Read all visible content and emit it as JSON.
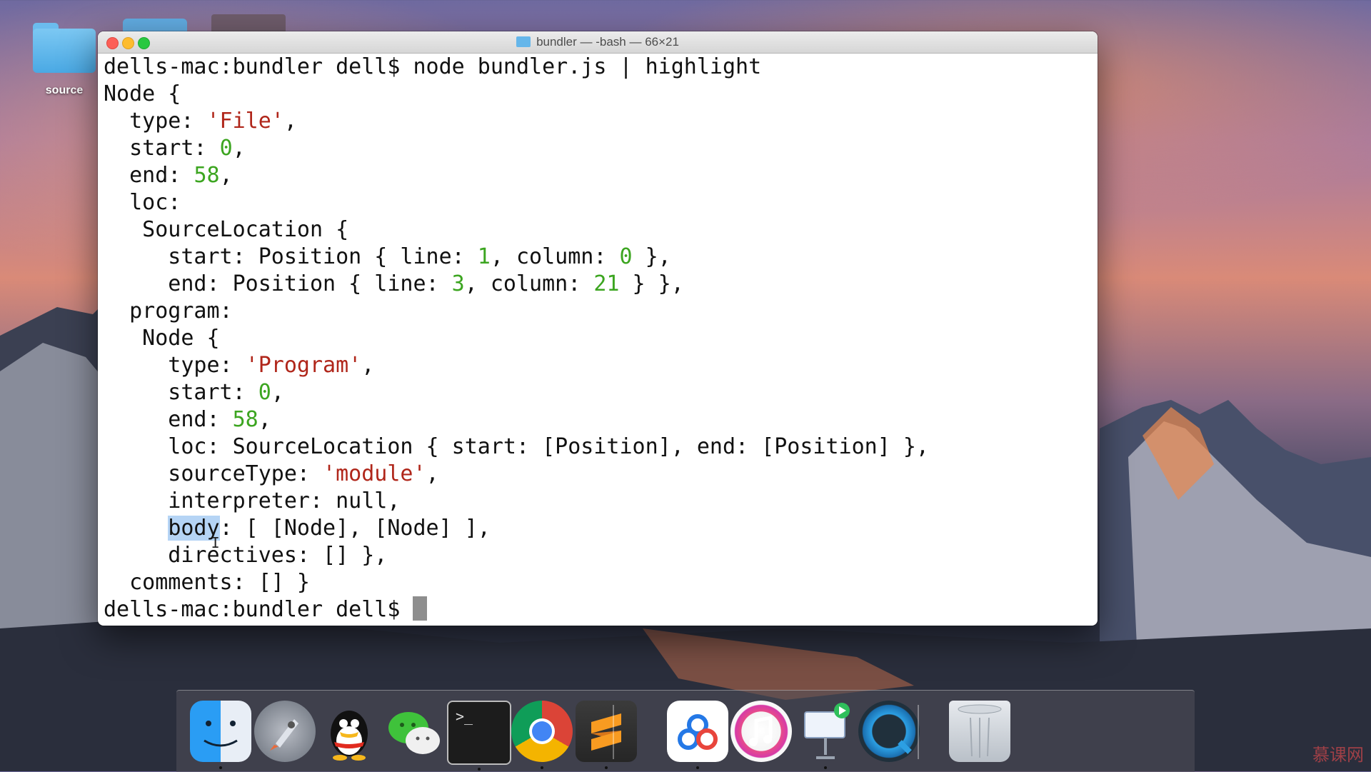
{
  "desktop": {
    "folder_label": "source"
  },
  "window": {
    "title": "bundler — -bash — 66×21",
    "lines": [
      [
        {
          "t": "dells-mac:bundler dell$ node bundler.js | highlight"
        }
      ],
      [
        {
          "t": "Node {"
        }
      ],
      [
        {
          "t": "  type: "
        },
        {
          "t": "'File'",
          "c": "str"
        },
        {
          "t": ","
        }
      ],
      [
        {
          "t": "  start: "
        },
        {
          "t": "0",
          "c": "num"
        },
        {
          "t": ","
        }
      ],
      [
        {
          "t": "  end: "
        },
        {
          "t": "58",
          "c": "num"
        },
        {
          "t": ","
        }
      ],
      [
        {
          "t": "  loc:"
        }
      ],
      [
        {
          "t": "   SourceLocation {"
        }
      ],
      [
        {
          "t": "     start: Position { line: "
        },
        {
          "t": "1",
          "c": "num"
        },
        {
          "t": ", column: "
        },
        {
          "t": "0",
          "c": "num"
        },
        {
          "t": " },"
        }
      ],
      [
        {
          "t": "     end: Position { line: "
        },
        {
          "t": "3",
          "c": "num"
        },
        {
          "t": ", column: "
        },
        {
          "t": "21",
          "c": "num"
        },
        {
          "t": " } },"
        }
      ],
      [
        {
          "t": "  program:"
        }
      ],
      [
        {
          "t": "   Node {"
        }
      ],
      [
        {
          "t": "     type: "
        },
        {
          "t": "'Program'",
          "c": "str"
        },
        {
          "t": ","
        }
      ],
      [
        {
          "t": "     start: "
        },
        {
          "t": "0",
          "c": "num"
        },
        {
          "t": ","
        }
      ],
      [
        {
          "t": "     end: "
        },
        {
          "t": "58",
          "c": "num"
        },
        {
          "t": ","
        }
      ],
      [
        {
          "t": "     loc: SourceLocation { start: [Position], end: [Position] },"
        }
      ],
      [
        {
          "t": "     sourceType: "
        },
        {
          "t": "'module'",
          "c": "str"
        },
        {
          "t": ","
        }
      ],
      [
        {
          "t": "     interpreter: null,"
        }
      ],
      [
        {
          "t": "     "
        },
        {
          "t": "body",
          "c": "sel"
        },
        {
          "t": ": [ [Node], [Node] ],"
        }
      ],
      [
        {
          "t": "     directives: [] },"
        }
      ],
      [
        {
          "t": "  comments: [] }"
        }
      ],
      [
        {
          "t": "dells-mac:bundler dell$ "
        },
        {
          "t": "",
          "c": "cursor"
        }
      ]
    ]
  },
  "dock": {
    "items": [
      {
        "name": "finder-icon",
        "cls": "finder",
        "running": true
      },
      {
        "name": "launchpad-icon",
        "cls": "rocket",
        "running": false
      },
      {
        "name": "qq-icon",
        "cls": "qq",
        "running": false
      },
      {
        "name": "wechat-icon",
        "cls": "wechat",
        "running": false
      },
      {
        "name": "terminal-icon",
        "cls": "terminal-ic",
        "running": true
      },
      {
        "name": "chrome-icon",
        "cls": "chrome",
        "running": true
      },
      {
        "name": "sublime-text-icon",
        "cls": "sublime",
        "running": true
      },
      {
        "name": "baidu-netdisk-icon",
        "cls": "baidu",
        "running": true
      },
      {
        "name": "itunes-icon",
        "cls": "itunes",
        "running": false
      },
      {
        "name": "keynote-icon",
        "cls": "keynote",
        "running": true
      },
      {
        "name": "quicktime-icon",
        "cls": "quicktime",
        "running": false
      },
      {
        "name": "trash-icon",
        "cls": "trash",
        "running": false
      }
    ]
  },
  "watermark": "慕课网"
}
